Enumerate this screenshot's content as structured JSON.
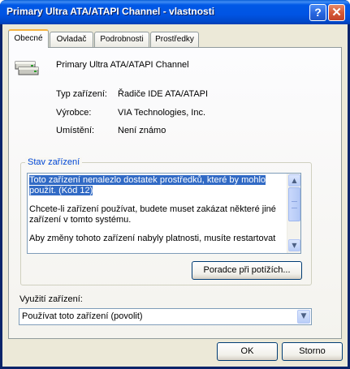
{
  "window": {
    "title": "Primary Ultra ATA/ATAPI Channel - vlastnosti",
    "help_button": "?",
    "close_button": "✕"
  },
  "tabs": [
    {
      "label": "Obecné",
      "active": true
    },
    {
      "label": "Ovladač",
      "active": false
    },
    {
      "label": "Podrobnosti",
      "active": false
    },
    {
      "label": "Prostředky",
      "active": false
    }
  ],
  "device": {
    "icon": "ide-controller-icon",
    "name": "Primary Ultra ATA/ATAPI Channel",
    "properties": [
      {
        "label": "Typ zařízení:",
        "value": "Řadiče IDE ATA/ATAPI"
      },
      {
        "label": "Výrobce:",
        "value": "VIA Technologies, Inc."
      },
      {
        "label": "Umístění:",
        "value": "Není známo"
      }
    ]
  },
  "status": {
    "group_label": "Stav zařízení",
    "selected_line1": "Toto zařízení nenalezlo dostatek prostředků, které by mohlo",
    "selected_line2": "použít. (Kód 12)",
    "para2_line1": "Chcete-li zařízení používat, budete muset zakázat některé jiné",
    "para2_line2": "zařízení v tomto systému.",
    "para3_line1": "Aby změny tohoto zařízení nabyly platnosti, musíte restartovat",
    "troubleshoot_button": "Poradce při potížích..."
  },
  "usage": {
    "label": "Využití zařízení:",
    "selected": "Používat toto zařízení (povolit)"
  },
  "footer": {
    "ok": "OK",
    "cancel": "Storno"
  },
  "colors": {
    "titlebar": "#0054e3",
    "dialog_bg": "#ece9d8",
    "selection": "#316ac5",
    "group_label": "#0046d5",
    "active_tab_accent": "#f4b23e"
  }
}
